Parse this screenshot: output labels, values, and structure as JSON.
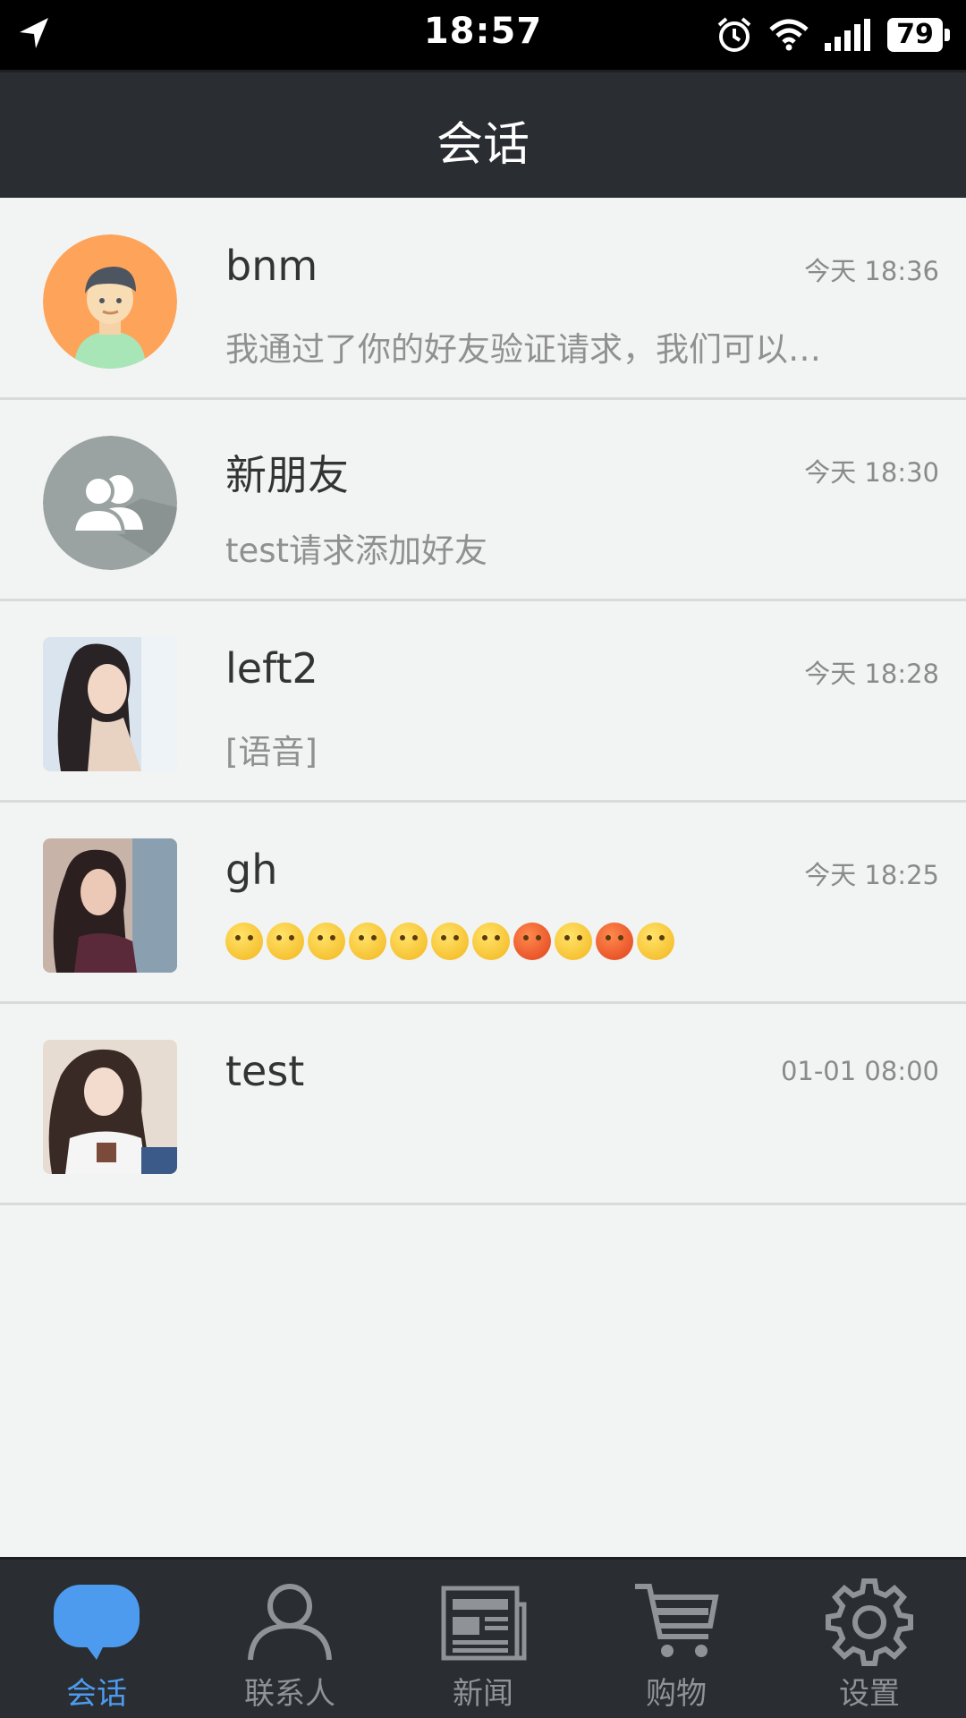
{
  "status_bar": {
    "time": "18:57",
    "battery": "79"
  },
  "nav": {
    "title": "会话"
  },
  "conversations": [
    {
      "name": "bnm",
      "time": "今天 18:36",
      "preview": "我通过了你的好友验证请求，我们可以…"
    },
    {
      "name": "新朋友",
      "time": "今天 18:30",
      "preview": "test请求添加好友"
    },
    {
      "name": "left2",
      "time": "今天 18:28",
      "preview": "[语音]"
    },
    {
      "name": "gh",
      "time": "今天 18:25",
      "preview": ""
    },
    {
      "name": "test",
      "time": "01-01 08:00",
      "preview": ""
    }
  ],
  "tabs": [
    {
      "label": "会话",
      "icon": "chat-bubble-icon",
      "active": true
    },
    {
      "label": "联系人",
      "icon": "contact-icon",
      "active": false
    },
    {
      "label": "新闻",
      "icon": "newspaper-icon",
      "active": false
    },
    {
      "label": "购物",
      "icon": "cart-icon",
      "active": false
    },
    {
      "label": "设置",
      "icon": "gear-icon",
      "active": false
    }
  ],
  "colors": {
    "accent": "#4d9bef",
    "bar": "#2a2d31",
    "background": "#f2f4f3"
  }
}
